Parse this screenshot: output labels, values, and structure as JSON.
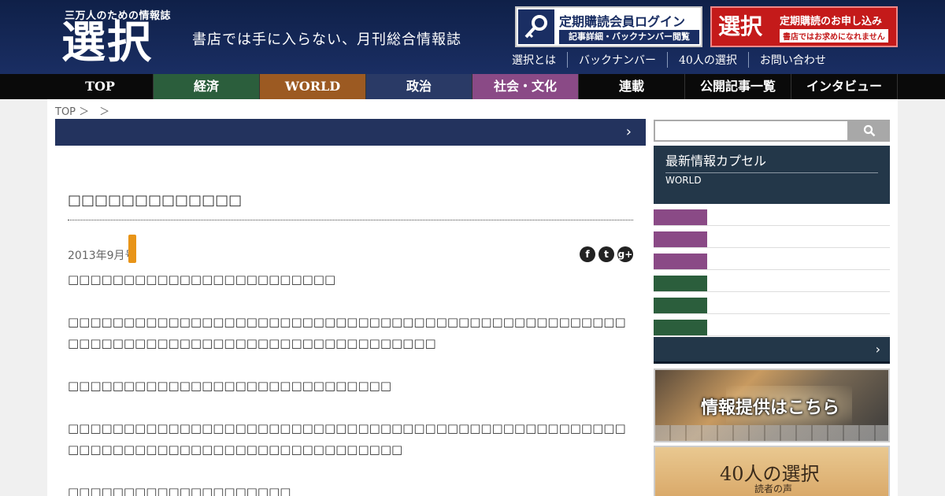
{
  "header": {
    "logo_sub": "三万人のための情報誌",
    "logo_main": "選択",
    "tagline": "書店では手に入らない、月刊総合情報誌",
    "login": {
      "title": "定期購読会員ログイン",
      "sub": "記事詳細・バックナンバー閲覧"
    },
    "subscribe": {
      "big": "選択",
      "title": "定期購読のお申し込み",
      "note": "書店ではお求めになれません"
    },
    "util_nav": [
      "選択とは",
      "バックナンバー",
      "40人の選択",
      "お問い合わせ"
    ]
  },
  "main_nav": [
    {
      "label": "TOP",
      "color": "#0a0a0a"
    },
    {
      "label": "経済",
      "color": "#2b5e3c"
    },
    {
      "label": "WORLD",
      "color": "#9c5a22"
    },
    {
      "label": "政治",
      "color": "#2a3a66"
    },
    {
      "label": "社会・文化",
      "color": "#8a4a86"
    },
    {
      "label": "連載",
      "color": "#0a0a0a"
    },
    {
      "label": "公開記事一覧",
      "color": "#0a0a0a"
    },
    {
      "label": "インタビュー",
      "color": "#0a0a0a"
    }
  ],
  "breadcrumb": "TOP ＞　＞",
  "title_bar_chevron": "›",
  "article": {
    "title": "□□□□□□□□□□□□□",
    "date": "2013年9月号",
    "social": [
      "f",
      "t",
      "g+"
    ],
    "paragraphs": [
      "□□□□□□□□□□□□□□□□□□□□□□□□",
      "□□□□□□□□□□□□□□□□□□□□□□□□□□□□□□□□□□□□□□□□□□□□□□□□□□□□□□□□□□□□□□□□□□□□□□□□□□□□□□□□□□□",
      "□□□□□□□□□□□□□□□□□□□□□□□□□□□□□",
      "□□□□□□□□□□□□□□□□□□□□□□□□□□□□□□□□□□□□□□□□□□□□□□□□□□□□□□□□□□□□□□□□□□□□□□□□□□□□□□□□",
      "□□□□□□□□□□□□□□□□□□□□"
    ]
  },
  "sidebar": {
    "search_placeholder": "",
    "capsule_title": "最新情報カプセル",
    "capsule_sub": "WORLD",
    "list_tag_colors": [
      "#8a4a86",
      "#8a4a86",
      "#8a4a86",
      "#2b5e3c",
      "#2b5e3c",
      "#2b5e3c"
    ],
    "more_chevron": "›",
    "banner1_text": "情報提供はこちら",
    "banner2_text": "40人の選択",
    "banner2_sub": "読者の声"
  }
}
